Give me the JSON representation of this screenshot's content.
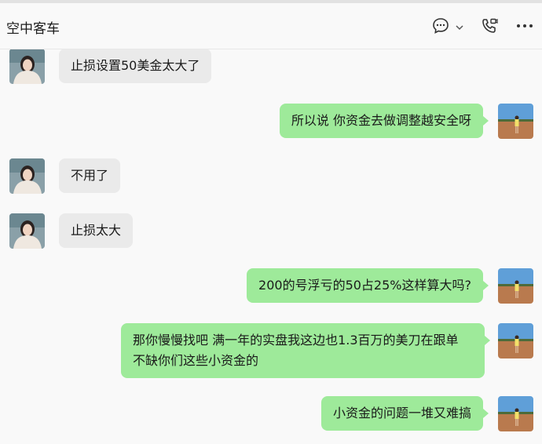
{
  "header": {
    "title": "空中客车",
    "icons": [
      "chat-bubble-icon",
      "chevron-down-icon",
      "video-call-icon",
      "more-icon"
    ]
  },
  "messages": [
    {
      "side": "left",
      "text": "止损设置50美金太大了"
    },
    {
      "side": "right",
      "text": "所以说 你资金去做调整越安全呀"
    },
    {
      "side": "left",
      "text": "不用了"
    },
    {
      "side": "left",
      "text": "止损太大"
    },
    {
      "side": "right",
      "text": "200的号浮亏的50占25%这样算大吗?"
    },
    {
      "side": "right",
      "text": "那你慢慢找吧 满一年的实盘我这边也1.3百万的美刀在跟单 不缺你们这些小资金的"
    },
    {
      "side": "right",
      "text": "小资金的问题一堆又难搞"
    }
  ],
  "colors": {
    "self_bubble": "#9eea9a",
    "other_bubble": "#eaeaea",
    "background": "#f9f9f9"
  }
}
